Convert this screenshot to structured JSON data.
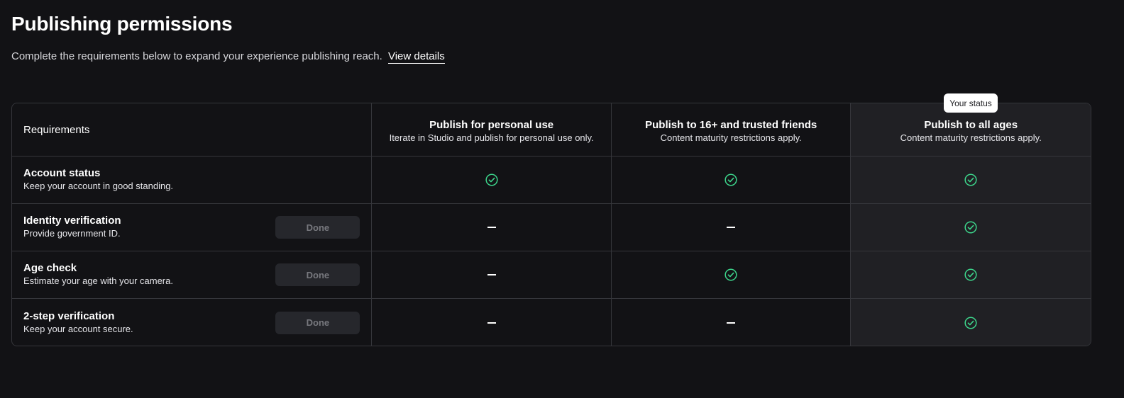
{
  "page": {
    "title": "Publishing permissions",
    "subtitle": "Complete the requirements below to expand your experience publishing reach.",
    "view_details": "View details"
  },
  "status_tooltip": "Your status",
  "table": {
    "requirements_header": "Requirements",
    "columns": [
      {
        "title": "Publish for personal use",
        "subtitle": "Iterate in Studio and publish for personal use only."
      },
      {
        "title": "Publish to 16+ and trusted friends",
        "subtitle": "Content maturity restrictions apply."
      },
      {
        "title": "Publish to all ages",
        "subtitle": "Content maturity restrictions apply.",
        "current_status": true
      }
    ],
    "rows": [
      {
        "title": "Account status",
        "description": "Keep your account in good standing.",
        "button": null,
        "cells": [
          "check",
          "check",
          "check"
        ]
      },
      {
        "title": "Identity verification",
        "description": "Provide government ID.",
        "button": "Done",
        "button_disabled": true,
        "cells": [
          "dash",
          "dash",
          "check"
        ]
      },
      {
        "title": "Age check",
        "description": "Estimate your age with your camera.",
        "button": "Done",
        "button_disabled": true,
        "cells": [
          "dash",
          "check",
          "check"
        ]
      },
      {
        "title": "2-step verification",
        "description": "Keep your account secure.",
        "button": "Done",
        "button_disabled": true,
        "cells": [
          "dash",
          "dash",
          "check"
        ]
      }
    ]
  },
  "icons": {
    "check": "check-circle-icon",
    "dash": "dash-icon"
  },
  "colors": {
    "background": "#121215",
    "highlight_column": "#202024",
    "check_green": "#3dd68c",
    "border": "#35363b"
  }
}
